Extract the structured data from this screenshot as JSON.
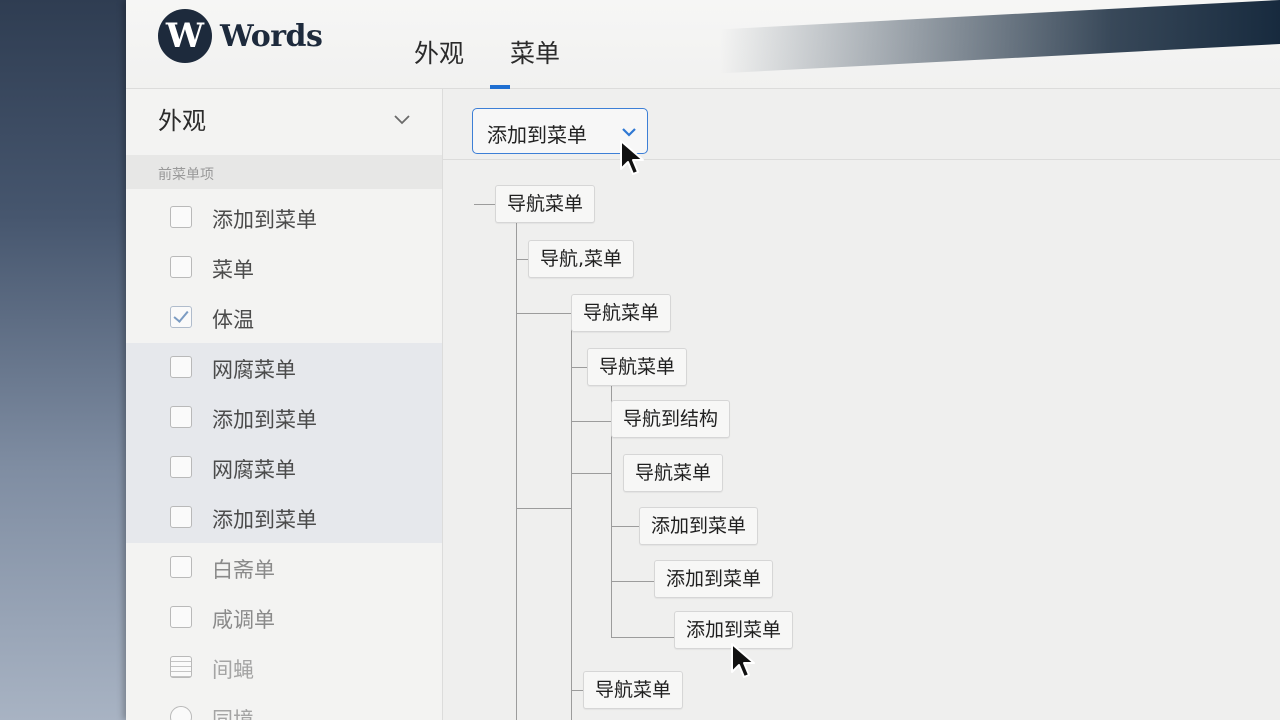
{
  "app": {
    "logo_letter": "W",
    "logo_text": "Words"
  },
  "tabs": [
    {
      "label": "外观"
    },
    {
      "label": "菜单",
      "active": true
    }
  ],
  "sidebar": {
    "heading": "外观",
    "section_label": "前菜单项",
    "items": [
      {
        "label": "添加到菜单",
        "checked": false
      },
      {
        "label": "菜单",
        "checked": false
      },
      {
        "label": "体温",
        "checked": true
      },
      {
        "label": "网腐菜单",
        "checked": false
      },
      {
        "label": "添加到菜单",
        "checked": false
      },
      {
        "label": "网腐菜单",
        "checked": false
      },
      {
        "label": "添加到菜单",
        "checked": false
      },
      {
        "label": "白斋单",
        "checked": false
      },
      {
        "label": "咸调单",
        "checked": false
      },
      {
        "label": "间蝇",
        "checked": false
      },
      {
        "label": "同境",
        "checked": false
      }
    ]
  },
  "toolbar": {
    "dropdown_value": "添加到菜单"
  },
  "tree": {
    "nodes": [
      {
        "label": "导航菜单"
      },
      {
        "label": "导航,菜单"
      },
      {
        "label": "导航菜单"
      },
      {
        "label": "导航菜单"
      },
      {
        "label": "导航到结构"
      },
      {
        "label": "导航菜单"
      },
      {
        "label": "添加到菜单"
      },
      {
        "label": "添加到菜单"
      },
      {
        "label": "添加到菜单"
      },
      {
        "label": "导航菜单"
      }
    ]
  },
  "colors": {
    "accent": "#1f6fd1",
    "logo": "#1d2a3c",
    "tree_line": "#9c9c9c",
    "bezel_dark": "#172a3e"
  },
  "icons": {
    "sidebar_toggle": "chevron-down-icon",
    "dropdown_toggle": "chevron-down-icon",
    "pointer": "mouse-cursor-icon"
  }
}
